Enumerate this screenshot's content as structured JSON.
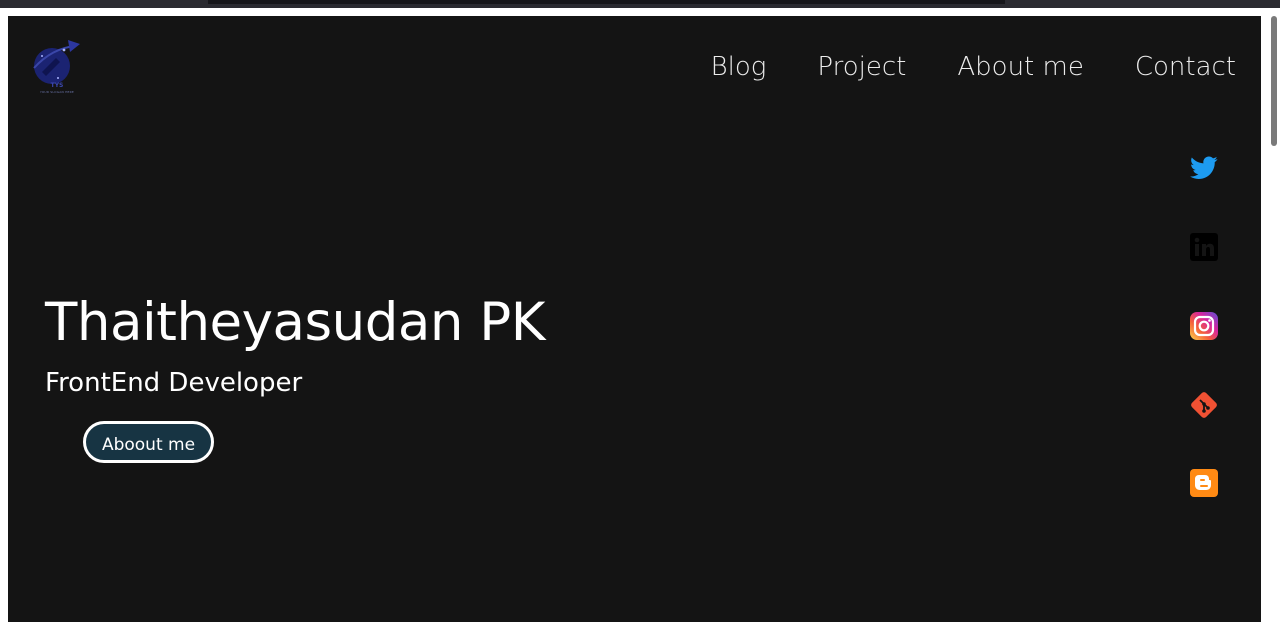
{
  "logo": {
    "monogram": "TYS",
    "tagline": "YOUR SLOGAN HERE"
  },
  "nav": {
    "items": [
      {
        "label": "Blog"
      },
      {
        "label": "Project"
      },
      {
        "label": "About me"
      },
      {
        "label": "Contact"
      }
    ]
  },
  "hero": {
    "name": "Thaitheyasudan PK",
    "role": "FrontEnd Developer",
    "button_label": "Aboout me"
  },
  "social": [
    {
      "icon": "twitter-icon",
      "color": "#1d9bf0"
    },
    {
      "icon": "linkedin-icon",
      "color": "#000000"
    },
    {
      "icon": "instagram-icon",
      "color": "#e1306c"
    },
    {
      "icon": "git-icon",
      "color": "#f05133"
    },
    {
      "icon": "blogger-icon",
      "color": "#ff8a14"
    }
  ],
  "colors": {
    "page_background": "#141414",
    "button_background": "#173443",
    "text": "#ffffff"
  }
}
